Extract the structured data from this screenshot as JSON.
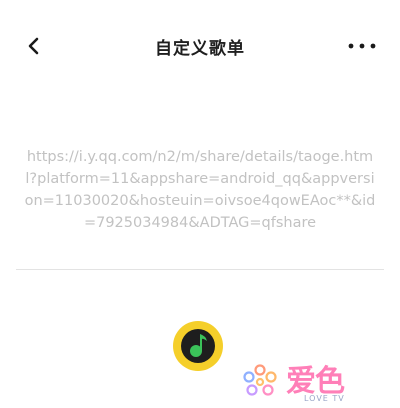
{
  "header": {
    "title": "自定义歌单",
    "back_icon": "chevron-left-icon",
    "more_icon": "more-horizontal-icon"
  },
  "url_input": {
    "value": "https://i.y.qq.com/n2/m/share/details/taoge.html?platform=11&appshare=android_qq&appversion=11030020&hosteuin=oivsoe4qowEAoc**&id=7925034984&ADTAG=qfshare"
  },
  "logo": {
    "icon": "qq-music-logo-icon",
    "colors": {
      "ring": "#f5cf2a",
      "core": "#1e1e1e",
      "note": "#3bc25a"
    }
  },
  "watermark": {
    "text": "爱色",
    "subtext": "LOVE TV",
    "colors": {
      "primary": "#ff7fb8",
      "secondary": "#8fb0ff"
    }
  }
}
